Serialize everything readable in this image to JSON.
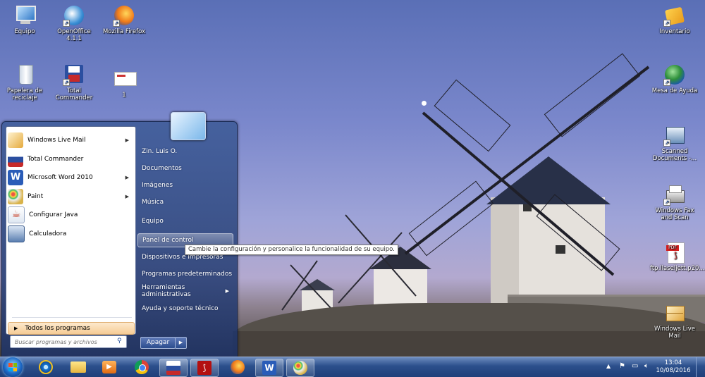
{
  "desktop_icons": [
    {
      "id": "equipo",
      "label": "Equipo",
      "icon": "computer-icon"
    },
    {
      "id": "openoffice",
      "label": "OpenOffice 4.1.1",
      "icon": "openoffice-icon"
    },
    {
      "id": "firefox",
      "label": "Mozilla Firefox",
      "icon": "firefox-icon"
    },
    {
      "id": "papelera",
      "label": "Papelera de reciclaje",
      "icon": "recycle-bin-icon"
    },
    {
      "id": "totalcmd",
      "label": "Total Commander",
      "icon": "floppy-icon"
    },
    {
      "id": "file1",
      "label": "1",
      "icon": "document-icon"
    },
    {
      "id": "inventario",
      "label": "Inventario",
      "icon": "folder-star-icon"
    },
    {
      "id": "mesa",
      "label": "Mesa de Ayuda",
      "icon": "globe-icon"
    },
    {
      "id": "scanned",
      "label": "Scanned Documents -...",
      "icon": "scanner-icon"
    },
    {
      "id": "fax",
      "label": "Windows Fax and Scan",
      "icon": "fax-icon"
    },
    {
      "id": "pdf",
      "label": "ftp.llaseljett.p20...",
      "icon": "pdf-icon"
    },
    {
      "id": "livemail",
      "label": "Windows Live Mail",
      "icon": "mail-icon"
    }
  ],
  "start_menu": {
    "programs": [
      {
        "label": "Windows Live Mail",
        "has_submenu": true,
        "icon": "mail-icon",
        "color": "#e5a93b"
      },
      {
        "label": "Total Commander",
        "has_submenu": false,
        "icon": "floppy-icon",
        "color": "#2b4fa0"
      },
      {
        "label": "Microsoft Word 2010",
        "has_submenu": true,
        "icon": "word-icon",
        "color": "#2a5cb8"
      },
      {
        "label": "Paint",
        "has_submenu": true,
        "icon": "paint-icon",
        "color": "#d9b34a"
      },
      {
        "label": "Configurar Java",
        "has_submenu": false,
        "icon": "java-icon",
        "color": "#c8452c"
      },
      {
        "label": "Calculadora",
        "has_submenu": false,
        "icon": "calculator-icon",
        "color": "#5b7fb0"
      }
    ],
    "all_programs": "Todos los programas",
    "search_placeholder": "Buscar programas y archivos",
    "right_items": [
      {
        "label": "Zin. Luis O.",
        "has_submenu": false
      },
      {
        "label": "Documentos",
        "has_submenu": false
      },
      {
        "label": "Imágenes",
        "has_submenu": false
      },
      {
        "label": "Música",
        "has_submenu": false
      },
      {
        "label": "Equipo",
        "has_submenu": false
      },
      {
        "label": "Panel de control",
        "has_submenu": false
      },
      {
        "label": "Dispositivos e impresoras",
        "has_submenu": false
      },
      {
        "label": "Programas predeterminados",
        "has_submenu": false
      },
      {
        "label": "Herramientas administrativas",
        "has_submenu": true
      },
      {
        "label": "Ayuda y soporte técnico",
        "has_submenu": false
      }
    ],
    "shutdown_label": "Apagar",
    "tooltip": "Cambie la configuración y personalice la funcionalidad de su equipo."
  },
  "taskbar": {
    "pinned": [
      {
        "id": "ie",
        "icon": "internet-explorer-icon"
      },
      {
        "id": "explorer",
        "icon": "folder-icon"
      },
      {
        "id": "media",
        "icon": "media-player-icon"
      },
      {
        "id": "chrome",
        "icon": "chrome-icon"
      },
      {
        "id": "totalcmd",
        "icon": "floppy-icon"
      },
      {
        "id": "acrobat",
        "icon": "acrobat-icon"
      },
      {
        "id": "firefox",
        "icon": "firefox-icon"
      },
      {
        "id": "word",
        "icon": "word-icon"
      },
      {
        "id": "paint",
        "icon": "paint-icon"
      }
    ],
    "time": "13:04",
    "date": "10/08/2016"
  }
}
